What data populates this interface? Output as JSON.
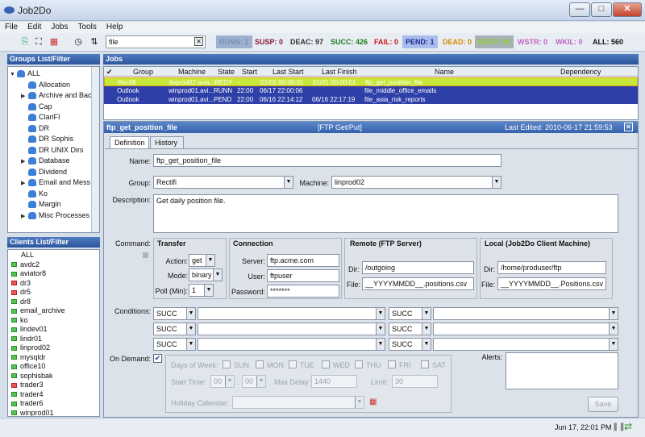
{
  "window": {
    "title": "Job2Do",
    "btn_min": "—",
    "btn_max": "□",
    "btn_close": "✕"
  },
  "menu": [
    "File",
    "Edit",
    "Jobs",
    "Tools",
    "Help"
  ],
  "toolbar": {
    "search_value": "file",
    "stats": [
      {
        "label": "RUNN: 1",
        "color": "#7b8fb4",
        "bg": "#9eb0d0"
      },
      {
        "label": "SUSP: 0",
        "color": "#8a1a3a",
        "bg": ""
      },
      {
        "label": "DEAC: 97",
        "color": "#333333",
        "bg": ""
      },
      {
        "label": "SUCC: 426",
        "color": "#1d7a1d",
        "bg": ""
      },
      {
        "label": "FAIL: 0",
        "color": "#c81a1a",
        "bg": ""
      },
      {
        "label": "PEND: 1",
        "color": "#1a2e8a",
        "bg": "#aabbee"
      },
      {
        "label": "DEAD: 0",
        "color": "#d68a00",
        "bg": ""
      },
      {
        "label": "REDY: 35",
        "color": "#8ad02a",
        "bg": "#a8b0b8"
      },
      {
        "label": "WSTR: 0",
        "color": "#c060c0",
        "bg": ""
      },
      {
        "label": "WKIL: 0",
        "color": "#c060c0",
        "bg": ""
      },
      {
        "label": "ALL: 560",
        "color": "#111111",
        "bg": ""
      }
    ]
  },
  "groups": {
    "title": "Groups List/Filter",
    "items": [
      {
        "label": "ALL",
        "arrow": "▼",
        "indent": 0
      },
      {
        "label": "Allocation",
        "arrow": "",
        "indent": 1
      },
      {
        "label": "Archive and Bac",
        "arrow": "▶",
        "indent": 1
      },
      {
        "label": "Cap",
        "arrow": "",
        "indent": 1
      },
      {
        "label": "ClariFI",
        "arrow": "",
        "indent": 1
      },
      {
        "label": "DR",
        "arrow": "",
        "indent": 1
      },
      {
        "label": "DR Sophis",
        "arrow": "",
        "indent": 1
      },
      {
        "label": "DR UNIX Dirs",
        "arrow": "",
        "indent": 1
      },
      {
        "label": "Database",
        "arrow": "▶",
        "indent": 1
      },
      {
        "label": "Dividend",
        "arrow": "",
        "indent": 1
      },
      {
        "label": "Email and Mess",
        "arrow": "▶",
        "indent": 1
      },
      {
        "label": "Ko",
        "arrow": "",
        "indent": 1
      },
      {
        "label": "Margin",
        "arrow": "",
        "indent": 1
      },
      {
        "label": "Misc Processes",
        "arrow": "▶",
        "indent": 1
      }
    ]
  },
  "clients": {
    "title": "Clients List/Filter",
    "items": [
      {
        "label": "ALL",
        "status": "none"
      },
      {
        "label": "avdc2",
        "status": "ok"
      },
      {
        "label": "aviator8",
        "status": "ok"
      },
      {
        "label": "dr3",
        "status": "down"
      },
      {
        "label": "dr5",
        "status": "down"
      },
      {
        "label": "dr8",
        "status": "ok"
      },
      {
        "label": "email_archive",
        "status": "ok"
      },
      {
        "label": "ko",
        "status": "ok"
      },
      {
        "label": "lindev01",
        "status": "ok"
      },
      {
        "label": "lindr01",
        "status": "ok"
      },
      {
        "label": "linprod02",
        "status": "ok"
      },
      {
        "label": "mysqldr",
        "status": "ok"
      },
      {
        "label": "office10",
        "status": "ok"
      },
      {
        "label": "sophisbak",
        "status": "ok"
      },
      {
        "label": "trader3",
        "status": "down"
      },
      {
        "label": "trader4",
        "status": "ok"
      },
      {
        "label": "trader6",
        "status": "ok"
      },
      {
        "label": "winprod01",
        "status": "ok"
      }
    ]
  },
  "jobs": {
    "title": "Jobs",
    "columns": [
      "Group",
      "Machine",
      "State",
      "Start",
      "Last Start",
      "Last Finish",
      "Name",
      "Dependency"
    ],
    "rows": [
      {
        "group": "Rectifi",
        "machine": "linprod02.avia...",
        "state": "REDY",
        "start": "-",
        "last_start": "01/01 00:00:01",
        "last_finish": "01/01 00:00:01",
        "name": "ftp_get_position_file",
        "dep": ""
      },
      {
        "group": "Outlook",
        "machine": "winprod01.avi...",
        "state": "RUNN",
        "start": "22:00",
        "last_start": "06/17 22:00:06",
        "last_finish": "",
        "name": "file_middle_office_emails",
        "dep": ""
      },
      {
        "group": "Outlook",
        "machine": "winprod01.avi...",
        "state": "PEND",
        "start": "22:00",
        "last_start": "06/16 22:14:12",
        "last_finish": "06/16 22:17:19",
        "name": "file_asia_risk_reports",
        "dep": ""
      }
    ]
  },
  "detail": {
    "job_name": "ftp_get_position_file",
    "type": "[FTP Get/Put]",
    "last_edited": "Last Edited:  2010-06-17 21:59:53",
    "tabs": [
      "Definition",
      "History"
    ],
    "name_label": "Name:",
    "name_value": "ftp_get_position_file",
    "group_label": "Group:",
    "group_value": "Rectifi",
    "machine_label": "Machine:",
    "machine_value": "linprod02",
    "desc_label": "Description:",
    "desc_value": "Get daily position file.",
    "command_label": "Command:",
    "transfer": {
      "title": "Transfer",
      "action_label": "Action:",
      "action": "get",
      "mode_label": "Mode:",
      "mode": "binary",
      "poll_label": "Poll (Min):",
      "poll": "1"
    },
    "connection": {
      "title": "Connection",
      "server_label": "Server:",
      "server": "ftp.acme.com",
      "user_label": "User:",
      "user": "ftpuser",
      "password_label": "Password:",
      "password": "*******"
    },
    "remote": {
      "title": "Remote (FTP Server)",
      "dir_label": "Dir:",
      "dir": "/outgoing",
      "file_label": "File:",
      "file": "__YYYYMMDD__.positions.csv"
    },
    "local": {
      "title": "Local (Job2Do Client Machine)",
      "dir_label": "Dir:",
      "dir": "/home/produser/ftp",
      "file_label": "File:",
      "file": "__YYYYMMDD__.Positions.csv"
    },
    "conditions_label": "Conditions:",
    "condition_value": "SUCC",
    "on_demand_label": "On Demand:",
    "days_label": "Days of Week:",
    "days": [
      "SUN",
      "MON",
      "TUE",
      "WED",
      "THU",
      "FRI",
      "SAT"
    ],
    "start_time_label": "Start Time:",
    "start_h": "00",
    "start_m": "00",
    "max_delay_label": "Max Delay:",
    "max_delay": "1440",
    "limit_label": "Limit:",
    "limit": "30",
    "holiday_label": "Holiday Calendar:",
    "alerts_label": "Alerts:",
    "save_label": "Save"
  },
  "status": {
    "datetime": "Jun 17, 22:01 PM"
  }
}
